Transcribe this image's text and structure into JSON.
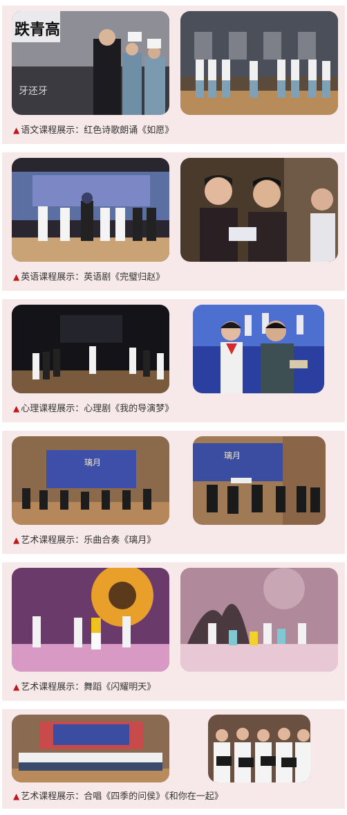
{
  "colors": {
    "card_bg": "#f7e9ea",
    "marker": "#c0171a",
    "text": "#333333"
  },
  "marker_icon": "red-triangle-icon",
  "sections": [
    {
      "caption": "▲语文课程展示：红色诗歌朗诵《如愿》",
      "photos": [
        {
          "scene": "students-reciting-with-signs",
          "sign_text": "跌青高",
          "screen_text": "牙还牙"
        },
        {
          "scene": "students-lined-on-stage-portraits"
        }
      ]
    },
    {
      "caption": "▲英语课程展示：英语剧《完璧归赵》",
      "photos": [
        {
          "scene": "drama-stage-costumes"
        },
        {
          "scene": "students-reading-scripts-closeup"
        }
      ]
    },
    {
      "caption": "▲心理课程展示：心理剧《我的导演梦》",
      "photos": [
        {
          "scene": "dark-stage-performers"
        },
        {
          "scene": "two-students-with-scripts"
        }
      ]
    },
    {
      "caption": "▲艺术课程展示：乐曲合奏《璃月》",
      "photos": [
        {
          "scene": "orchestra-on-stage",
          "screen_text": "璃月"
        },
        {
          "scene": "orchestra-closeup",
          "screen_text": "璃月"
        }
      ]
    },
    {
      "caption": "▲艺术课程展示：舞蹈《闪耀明天》",
      "photos": [
        {
          "scene": "dancers-sunflower-backdrop"
        },
        {
          "scene": "dancers-silhouette-backdrop"
        }
      ]
    },
    {
      "caption": "▲艺术课程展示：合唱《四季的问侯》《和你在一起》",
      "photos": [
        {
          "scene": "choir-wide"
        },
        {
          "scene": "choir-closeup-folders"
        }
      ]
    }
  ]
}
